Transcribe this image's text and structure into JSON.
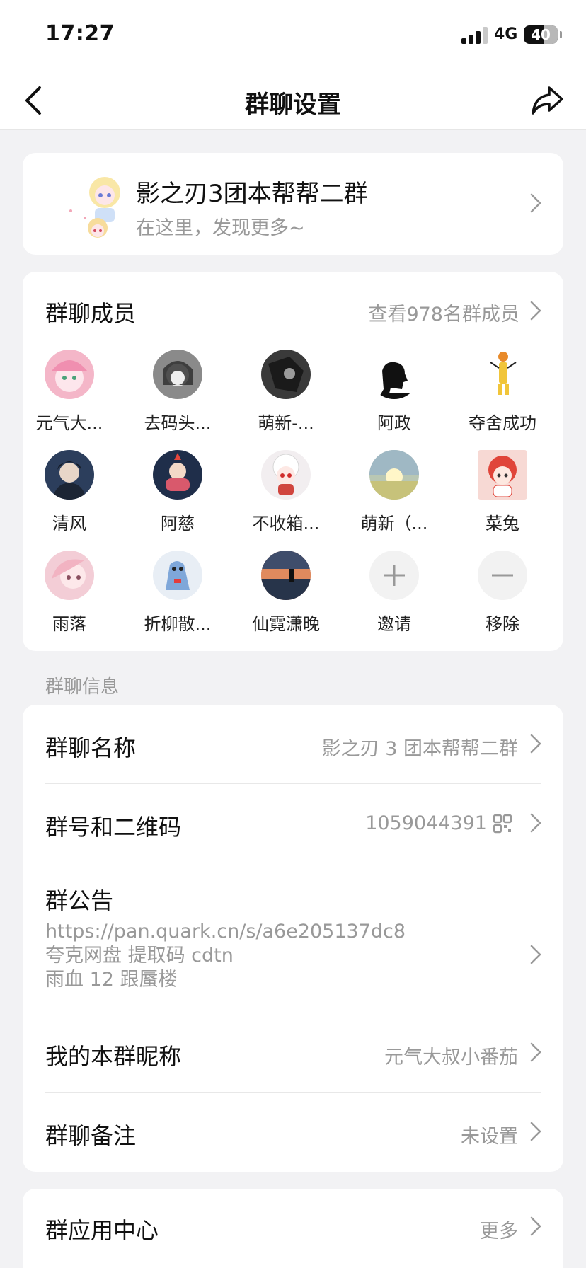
{
  "status_bar": {
    "time": "17:27",
    "network": "4G",
    "battery": "40"
  },
  "nav": {
    "title": "群聊设置",
    "back_icon": "chevron-left-icon",
    "share_icon": "share-icon"
  },
  "group": {
    "name": "影之刃3团本帮帮二群",
    "subtitle": "在这里，发现更多~"
  },
  "members": {
    "title": "群聊成员",
    "view_all": "查看978名群成员",
    "list": [
      {
        "name": "元气大...",
        "color": "#f4b6c8"
      },
      {
        "name": "去码头...",
        "color": "#8a8a8a"
      },
      {
        "name": "萌新-...",
        "color": "#3a3a3a"
      },
      {
        "name": "阿政",
        "color": "#ffffff"
      },
      {
        "name": "夺舍成功",
        "color": "#ffffff"
      },
      {
        "name": "清风",
        "color": "#2c3e5c"
      },
      {
        "name": "阿慈",
        "color": "#1f2e4a"
      },
      {
        "name": "不收箱...",
        "color": "#f2eef0"
      },
      {
        "name": "萌新（...",
        "color": "#b9c7b3"
      },
      {
        "name": "菜兔",
        "color": "#f7d9d4"
      },
      {
        "name": "雨落",
        "color": "#f3cdd6"
      },
      {
        "name": "折柳散...",
        "color": "#e8eef5"
      },
      {
        "name": "仙霓潇晚",
        "color": "#d88a6a"
      }
    ],
    "invite_label": "邀请",
    "remove_label": "移除"
  },
  "info_section_label": "群聊信息",
  "info": {
    "name_label": "群聊名称",
    "name_value": "影之刃 3 团本帮帮二群",
    "id_label": "群号和二维码",
    "id_value": "1059044391",
    "notice_label": "群公告",
    "notice_lines": [
      "https://pan.quark.cn/s/a6e205137dc8",
      "夸克网盘 提取码 cdtn",
      "雨血 12 跟蜃楼"
    ],
    "nickname_label": "我的本群昵称",
    "nickname_value": "元气大叔小番茄",
    "remark_label": "群聊备注",
    "remark_value": "未设置"
  },
  "apps": {
    "label": "群应用中心",
    "more": "更多"
  }
}
